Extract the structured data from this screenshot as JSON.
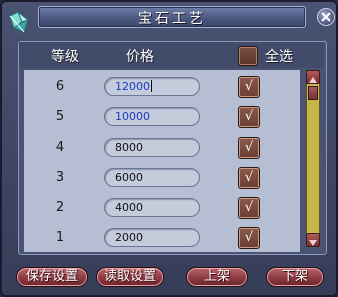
{
  "window": {
    "title": "宝石工艺"
  },
  "header": {
    "level_label": "等级",
    "price_label": "价格",
    "select_all_label": "全选"
  },
  "rows": [
    {
      "level": "6",
      "price": "12000",
      "checked_mark": "√"
    },
    {
      "level": "5",
      "price": "10000",
      "checked_mark": "√"
    },
    {
      "level": "4",
      "price": "8000",
      "checked_mark": "√"
    },
    {
      "level": "3",
      "price": "6000",
      "checked_mark": "√"
    },
    {
      "level": "2",
      "price": "4000",
      "checked_mark": "√"
    },
    {
      "level": "1",
      "price": "2000",
      "checked_mark": "√"
    }
  ],
  "buttons": {
    "save": "保存设置",
    "load": "读取设置",
    "list": "上架",
    "delist": "下架"
  },
  "icons": {
    "window_icon": "gem-icon",
    "close": "close-icon"
  },
  "colors": {
    "accent_button": "#8e3a42",
    "checkbox": "#6a3e32",
    "scrollbar": "#c7b64a",
    "highlight_text": "#1a3cc0"
  }
}
